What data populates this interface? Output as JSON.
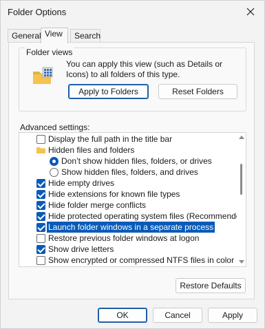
{
  "window": {
    "title": "Folder Options"
  },
  "tabs": [
    {
      "label": "General"
    },
    {
      "label": "View"
    },
    {
      "label": "Search"
    }
  ],
  "folder_views": {
    "legend": "Folder views",
    "description": "You can apply this view (such as Details or Icons) to all folders of this type.",
    "apply_label": "Apply to Folders",
    "reset_label": "Reset Folders"
  },
  "advanced": {
    "label": "Advanced settings:",
    "items": [
      {
        "label": "Display the full path in the title bar",
        "type": "checkbox",
        "checked": false
      },
      {
        "label": "Hidden files and folders",
        "type": "folder"
      },
      {
        "label": "Don’t show hidden files, folders, or drives",
        "type": "radio",
        "checked": true
      },
      {
        "label": "Show hidden files, folders, and drives",
        "type": "radio",
        "checked": false
      },
      {
        "label": "Hide empty drives",
        "type": "checkbox",
        "checked": true
      },
      {
        "label": "Hide extensions for known file types",
        "type": "checkbox",
        "checked": true
      },
      {
        "label": "Hide folder merge conflicts",
        "type": "checkbox",
        "checked": true
      },
      {
        "label": "Hide protected operating system files (Recommended)",
        "type": "checkbox",
        "checked": true
      },
      {
        "label": "Launch folder windows in a separate process",
        "type": "checkbox",
        "checked": true,
        "selected": true
      },
      {
        "label": "Restore previous folder windows at logon",
        "type": "checkbox",
        "checked": false
      },
      {
        "label": "Show drive letters",
        "type": "checkbox",
        "checked": true
      },
      {
        "label": "Show encrypted or compressed NTFS files in color",
        "type": "checkbox",
        "checked": false
      }
    ]
  },
  "restore_defaults_label": "Restore Defaults",
  "footer": {
    "ok_label": "OK",
    "cancel_label": "Cancel",
    "apply_label": "Apply"
  },
  "colors": {
    "accent": "#0a5bb8",
    "folder": "#f4c350"
  }
}
